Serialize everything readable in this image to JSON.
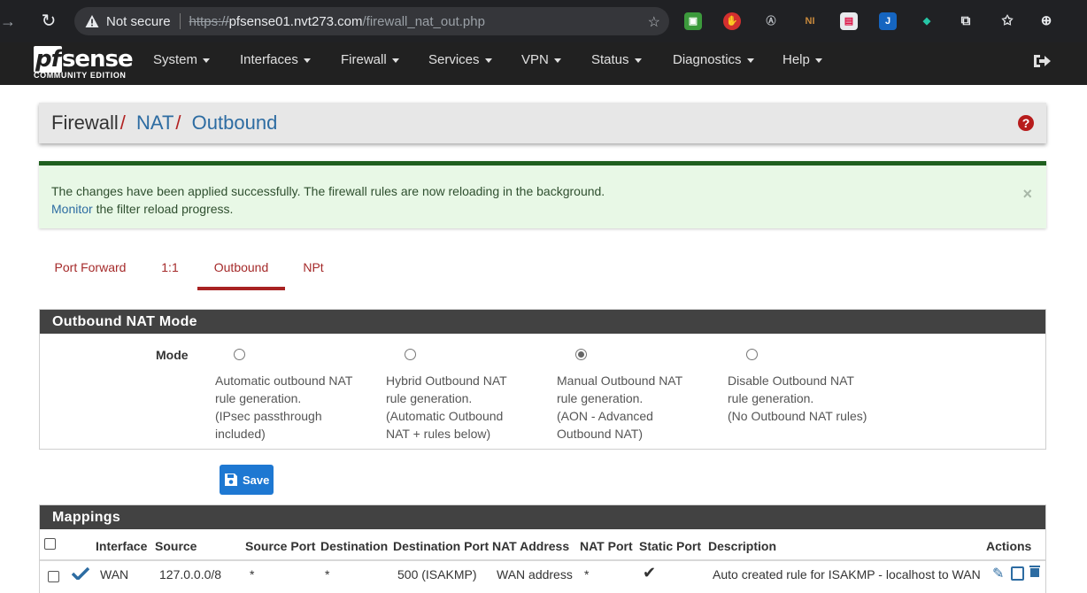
{
  "browser": {
    "security_label": "Not secure",
    "url_scheme": "https://",
    "url_host": "pfsense01.nvt273.com",
    "url_path": "/firewall_nat_out.php",
    "icons": [
      "back-arrow-icon",
      "reload-icon",
      "warning-icon",
      "add-favorite-icon",
      "extensions-icon",
      "favorites-icon",
      "collections-icon"
    ]
  },
  "navbar": {
    "brand": "sense",
    "brand_prefix": "pf",
    "edition": "COMMUNITY EDITION",
    "menus": [
      "System",
      "Interfaces",
      "Firewall",
      "Services",
      "VPN",
      "Status",
      "Diagnostics",
      "Help"
    ]
  },
  "breadcrumb": {
    "root": "Firewall",
    "level2": "NAT",
    "level3": "Outbound",
    "separator": "/"
  },
  "alert": {
    "message": "The changes have been applied successfully. The firewall rules are now reloading in the background.",
    "link": "Monitor",
    "suffix": " the filter reload progress.",
    "close": "×"
  },
  "tabs": [
    "Port Forward",
    "1:1",
    "Outbound",
    "NPt"
  ],
  "active_tab": "Outbound",
  "mode_panel": {
    "title": "Outbound NAT Mode",
    "label": "Mode",
    "options": [
      {
        "l1": "Automatic outbound NAT",
        "l2": "rule generation.",
        "l3": "(IPsec passthrough",
        "l4": "included)"
      },
      {
        "l1": "Hybrid Outbound NAT",
        "l2": "rule generation.",
        "l3": "(Automatic Outbound",
        "l4": "NAT + rules below)"
      },
      {
        "l1": "Manual Outbound NAT",
        "l2": "rule generation.",
        "l3": "(AON - Advanced",
        "l4": "Outbound NAT)"
      },
      {
        "l1": "Disable Outbound NAT",
        "l2": "rule generation.",
        "l3": "(No Outbound NAT rules)",
        "l4": ""
      }
    ],
    "selected_index": 2,
    "save_label": "Save"
  },
  "mappings": {
    "title": "Mappings",
    "columns": [
      "Interface",
      "Source",
      "Source Port",
      "Destination",
      "Destination Port",
      "NAT Address",
      "NAT Port",
      "Static Port",
      "Description",
      "Actions"
    ],
    "rows": [
      {
        "interface": "WAN",
        "source": "127.0.0.0/8",
        "source_port": "*",
        "destination": "*",
        "destination_port": "500 (ISAKMP)",
        "nat_address": "WAN address",
        "nat_port": "*",
        "static_port": "✔",
        "description": "Auto created rule for ISAKMP - localhost to WAN"
      }
    ]
  },
  "colors": {
    "navbar": "#212121",
    "tab_accent": "#a82222",
    "link": "#2d6ca2",
    "alert_bg": "#e8f8e6",
    "alert_border": "#1f5f1f",
    "panel_heading": "#424242",
    "save_button": "#1e78d2"
  }
}
